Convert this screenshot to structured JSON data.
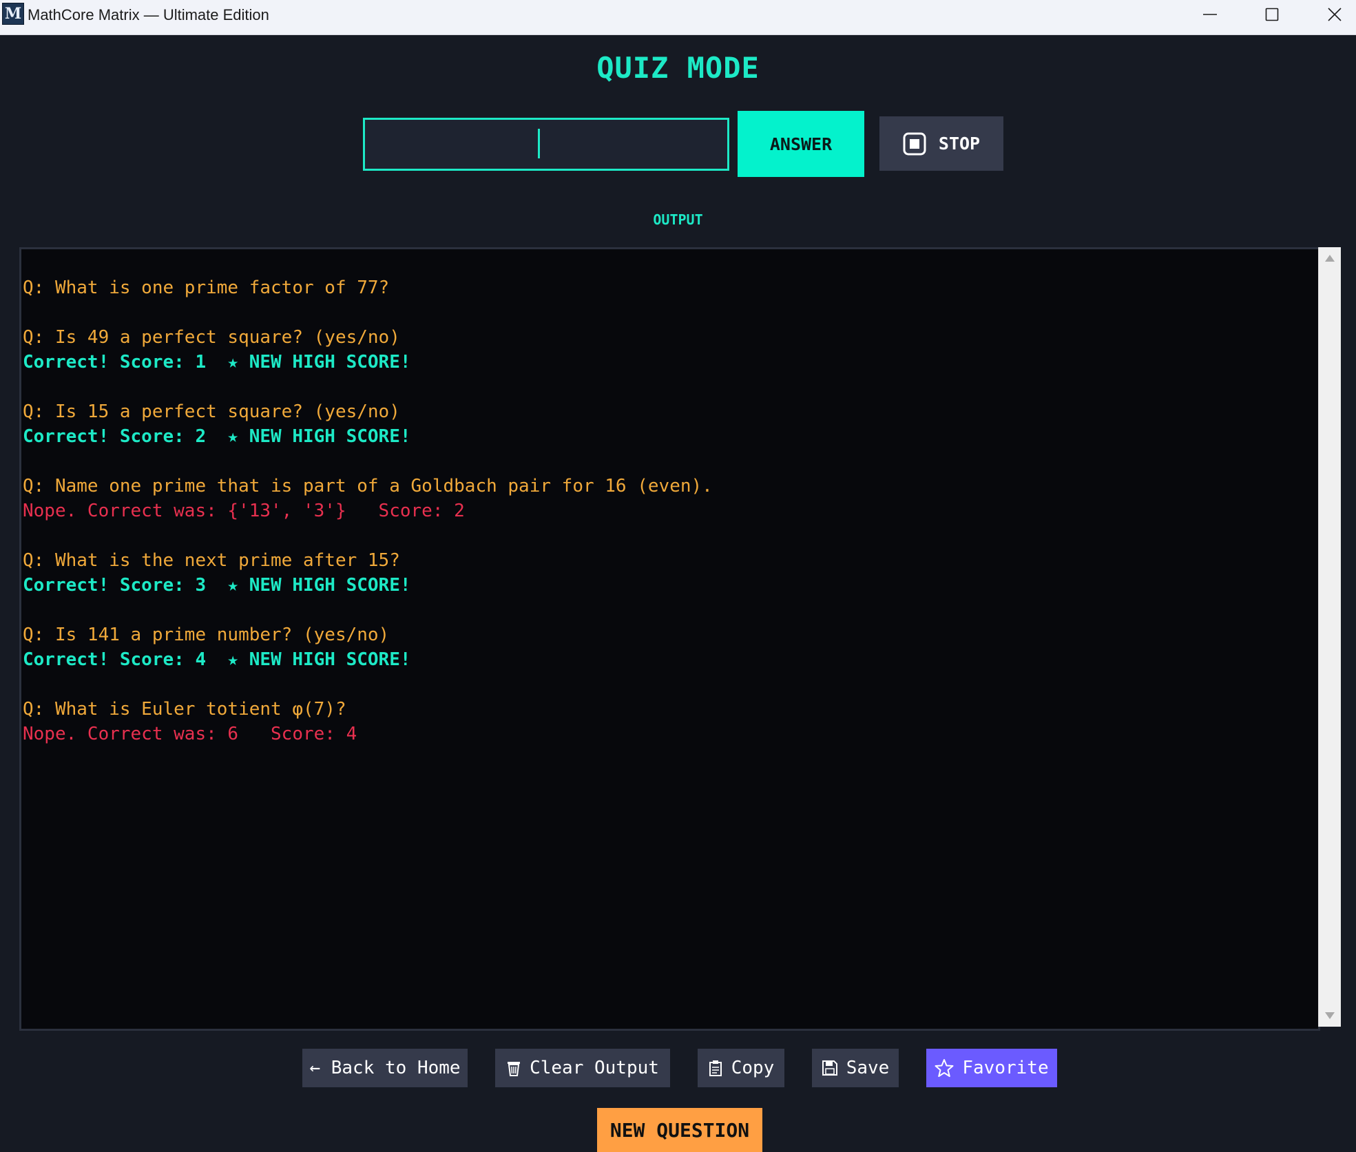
{
  "window": {
    "title": "MathCore Matrix — Ultimate Edition",
    "icon_letter": "M"
  },
  "quiz": {
    "title": "QUIZ MODE",
    "answer_value": "",
    "answer_label": "ANSWER",
    "stop_label": "STOP",
    "output_label": "OUTPUT"
  },
  "output": {
    "lines": [
      {
        "kind": "q",
        "text": "Q: What is one prime factor of 77?"
      },
      {
        "kind": "blank",
        "text": ""
      },
      {
        "kind": "q",
        "text": "Q: Is 49 a perfect square? (yes/no)"
      },
      {
        "kind": "ok",
        "text": "Correct! Score: 1  ★ NEW HIGH SCORE!"
      },
      {
        "kind": "blank",
        "text": ""
      },
      {
        "kind": "q",
        "text": "Q: Is 15 a perfect square? (yes/no)"
      },
      {
        "kind": "ok",
        "text": "Correct! Score: 2  ★ NEW HIGH SCORE!"
      },
      {
        "kind": "blank",
        "text": ""
      },
      {
        "kind": "q",
        "text": "Q: Name one prime that is part of a Goldbach pair for 16 (even)."
      },
      {
        "kind": "bad",
        "text": "Nope. Correct was: {'13', '3'}   Score: 2"
      },
      {
        "kind": "blank",
        "text": ""
      },
      {
        "kind": "q",
        "text": "Q: What is the next prime after 15?"
      },
      {
        "kind": "ok",
        "text": "Correct! Score: 3  ★ NEW HIGH SCORE!"
      },
      {
        "kind": "blank",
        "text": ""
      },
      {
        "kind": "q",
        "text": "Q: Is 141 a prime number? (yes/no)"
      },
      {
        "kind": "ok",
        "text": "Correct! Score: 4  ★ NEW HIGH SCORE!"
      },
      {
        "kind": "blank",
        "text": ""
      },
      {
        "kind": "q",
        "text": "Q: What is Euler totient φ(7)?"
      },
      {
        "kind": "bad",
        "text": "Nope. Correct was: 6   Score: 4"
      }
    ]
  },
  "actions": {
    "back_label": "← Back to Home",
    "clear_label": "Clear Output",
    "copy_label": "Copy",
    "save_label": "Save",
    "favorite_label": "Favorite"
  },
  "new_question_label": "NEW QUESTION",
  "colors": {
    "accent": "#1de9c6",
    "question": "#f0a93a",
    "correct": "#1de9c6",
    "wrong": "#e8304f",
    "favorite": "#6b5bff",
    "new_question": "#ff9f43"
  },
  "icons": {
    "stop": "stop-square-icon",
    "clear": "trash-icon",
    "copy": "clipboard-icon",
    "save": "floppy-disk-icon",
    "favorite": "star-outline-icon"
  }
}
